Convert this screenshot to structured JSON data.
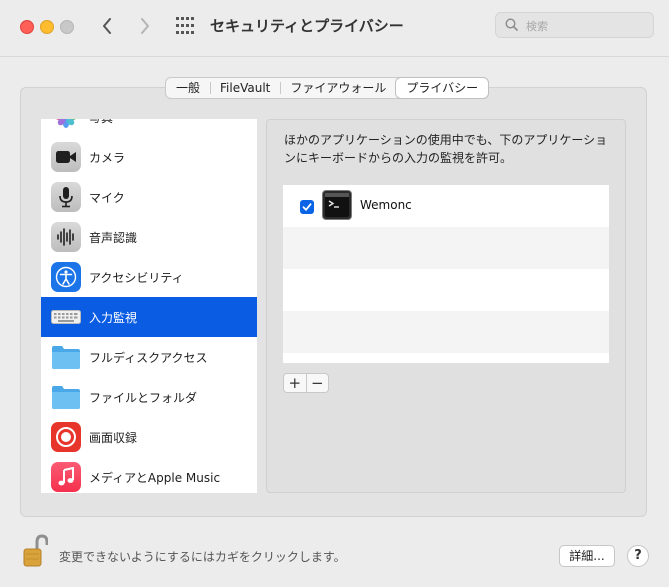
{
  "window": {
    "title": "セキュリティとプライバシー",
    "search_placeholder": "検索"
  },
  "tabs": [
    {
      "label": "一般",
      "active": false
    },
    {
      "label": "FileVault",
      "active": false
    },
    {
      "label": "ファイアウォール",
      "active": false
    },
    {
      "label": "プライバシー",
      "active": true
    }
  ],
  "sidebar": {
    "items": [
      {
        "label": "写真",
        "icon": "photos-icon"
      },
      {
        "label": "カメラ",
        "icon": "camera-icon"
      },
      {
        "label": "マイク",
        "icon": "microphone-icon"
      },
      {
        "label": "音声認識",
        "icon": "speech-recognition-icon"
      },
      {
        "label": "アクセシビリティ",
        "icon": "accessibility-icon"
      },
      {
        "label": "入力監視",
        "icon": "keyboard-icon",
        "selected": true
      },
      {
        "label": "フルディスクアクセス",
        "icon": "folder-icon"
      },
      {
        "label": "ファイルとフォルダ",
        "icon": "folder-icon"
      },
      {
        "label": "画面収録",
        "icon": "screen-recording-icon"
      },
      {
        "label": "メディアとApple Music",
        "icon": "music-icon"
      }
    ]
  },
  "main": {
    "description": "ほかのアプリケーションの使用中でも、下のアプリケーションにキーボードからの入力の監視を許可。",
    "apps": [
      {
        "name": "Wemonc",
        "checked": true,
        "icon": "terminal-icon"
      }
    ],
    "add_label": "+",
    "remove_label": "−"
  },
  "footer": {
    "lock_text": "変更できないようにするにはカギをクリックします。",
    "details_label": "詳細...",
    "help_label": "?"
  },
  "colors": {
    "selection": "#0a5ce3",
    "checkbox": "#0a64e6"
  }
}
